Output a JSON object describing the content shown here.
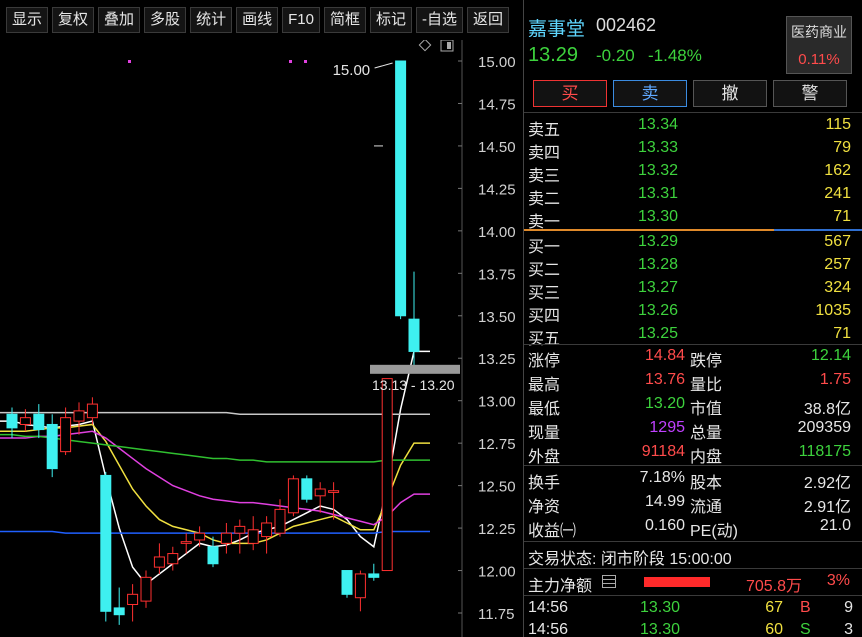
{
  "toolbar": {
    "buttons": [
      "显示",
      "复权",
      "叠加",
      "多股",
      "统计",
      "画线",
      "F10",
      "简框",
      "标记",
      "-自选",
      "返回"
    ]
  },
  "chart": {
    "price_axis": [
      "15.00",
      "14.75",
      "14.50",
      "14.25",
      "14.00",
      "13.75",
      "13.50",
      "13.25",
      "13.00",
      "12.75",
      "12.50",
      "12.25",
      "12.00",
      "11.75"
    ],
    "high_marker": "15.00",
    "range_label": "13.13 - 13.20",
    "colors": {
      "up": "#ff3030",
      "down": "#3ef0f0",
      "ma5": "#ffffff",
      "ma10": "#f0e040",
      "ma20": "#e040e0",
      "ma60": "#30c030",
      "ma120": "#2060ff",
      "ma250": "#c8c8c8"
    }
  },
  "chart_data": {
    "type": "candlestick",
    "ylim": [
      11.65,
      15.12
    ],
    "candles": [
      {
        "o": 12.92,
        "h": 12.96,
        "c": 12.84,
        "l": 12.78
      },
      {
        "o": 12.86,
        "h": 12.95,
        "c": 12.9,
        "l": 12.82
      },
      {
        "o": 12.92,
        "h": 12.98,
        "c": 12.83,
        "l": 12.78
      },
      {
        "o": 12.86,
        "h": 12.92,
        "c": 12.6,
        "l": 12.55
      },
      {
        "o": 12.7,
        "h": 12.96,
        "c": 12.9,
        "l": 12.68
      },
      {
        "o": 12.88,
        "h": 12.99,
        "c": 12.94,
        "l": 12.8
      },
      {
        "o": 12.9,
        "h": 13.02,
        "c": 12.98,
        "l": 12.86
      },
      {
        "o": 12.56,
        "h": 12.58,
        "c": 11.76,
        "l": 11.7
      },
      {
        "o": 11.78,
        "h": 11.9,
        "c": 11.74,
        "l": 11.68
      },
      {
        "o": 11.8,
        "h": 11.92,
        "c": 11.86,
        "l": 11.7
      },
      {
        "o": 11.82,
        "h": 12.0,
        "c": 11.96,
        "l": 11.78
      },
      {
        "o": 12.02,
        "h": 12.16,
        "c": 12.08,
        "l": 11.98
      },
      {
        "o": 12.04,
        "h": 12.14,
        "c": 12.1,
        "l": 12.0
      },
      {
        "o": 12.16,
        "h": 12.22,
        "c": 12.17,
        "l": 12.1
      },
      {
        "o": 12.18,
        "h": 12.26,
        "c": 12.22,
        "l": 12.14
      },
      {
        "o": 12.14,
        "h": 12.2,
        "c": 12.04,
        "l": 12.02
      },
      {
        "o": 12.16,
        "h": 12.28,
        "c": 12.22,
        "l": 12.1
      },
      {
        "o": 12.22,
        "h": 12.3,
        "c": 12.26,
        "l": 12.1
      },
      {
        "o": 12.16,
        "h": 12.32,
        "c": 12.24,
        "l": 12.12
      },
      {
        "o": 12.2,
        "h": 12.32,
        "c": 12.28,
        "l": 12.1
      },
      {
        "o": 12.22,
        "h": 12.42,
        "c": 12.36,
        "l": 12.2
      },
      {
        "o": 12.34,
        "h": 12.56,
        "c": 12.54,
        "l": 12.32
      },
      {
        "o": 12.54,
        "h": 12.56,
        "c": 12.42,
        "l": 12.4
      },
      {
        "o": 12.44,
        "h": 12.52,
        "c": 12.48,
        "l": 12.34
      },
      {
        "o": 12.46,
        "h": 12.52,
        "c": 12.47,
        "l": 12.3
      },
      {
        "o": 12.0,
        "h": 12.0,
        "c": 11.86,
        "l": 11.84
      },
      {
        "o": 11.84,
        "h": 12.0,
        "c": 11.98,
        "l": 11.76
      },
      {
        "o": 11.98,
        "h": 12.04,
        "c": 11.96,
        "l": 11.94
      },
      {
        "o": 12.0,
        "h": 13.13,
        "c": 13.13,
        "l": 12.0
      },
      {
        "o": 15.0,
        "h": 15.0,
        "c": 13.5,
        "l": 13.48
      },
      {
        "o": 13.48,
        "h": 13.76,
        "c": 13.29,
        "l": 13.2
      }
    ],
    "ma_lines": [
      {
        "name": "MA5",
        "values": [
          12.88,
          12.86,
          12.85,
          12.84,
          12.85,
          12.86,
          12.88,
          12.55,
          12.25,
          12.02,
          11.92,
          11.98,
          12.04,
          12.1,
          12.16,
          12.14,
          12.15,
          12.18,
          12.22,
          12.24,
          12.26,
          12.3,
          12.34,
          12.38,
          12.36,
          12.3,
          12.2,
          12.14,
          12.5,
          12.95,
          13.29
        ]
      },
      {
        "name": "MA10",
        "values": [
          12.82,
          12.82,
          12.83,
          12.84,
          12.84,
          12.85,
          12.86,
          12.76,
          12.62,
          12.48,
          12.38,
          12.3,
          12.26,
          12.24,
          12.22,
          12.18,
          12.16,
          12.16,
          12.16,
          12.18,
          12.22,
          12.26,
          12.28,
          12.3,
          12.32,
          12.28,
          12.24,
          12.24,
          12.42,
          12.62,
          12.75
        ]
      },
      {
        "name": "MA20",
        "values": [
          12.78,
          12.78,
          12.79,
          12.79,
          12.8,
          12.81,
          12.82,
          12.78,
          12.72,
          12.66,
          12.6,
          12.55,
          12.5,
          12.47,
          12.44,
          12.42,
          12.41,
          12.4,
          12.4,
          12.39,
          12.38,
          12.37,
          12.36,
          12.35,
          12.33,
          12.31,
          12.29,
          12.27,
          12.32,
          12.4,
          12.45
        ]
      },
      {
        "name": "MA60",
        "values": [
          12.8,
          12.79,
          12.79,
          12.78,
          12.77,
          12.76,
          12.75,
          12.74,
          12.73,
          12.72,
          12.71,
          12.7,
          12.69,
          12.68,
          12.67,
          12.66,
          12.66,
          12.65,
          12.65,
          12.64,
          12.64,
          12.64,
          12.64,
          12.64,
          12.64,
          12.64,
          12.64,
          12.64,
          12.65,
          12.65,
          12.65
        ]
      },
      {
        "name": "MA120",
        "values": [
          12.23,
          12.23,
          12.23,
          12.23,
          12.22,
          12.22,
          12.22,
          12.22,
          12.22,
          12.22,
          12.22,
          12.22,
          12.22,
          12.22,
          12.22,
          12.22,
          12.22,
          12.22,
          12.22,
          12.22,
          12.22,
          12.22,
          12.22,
          12.22,
          12.22,
          12.22,
          12.22,
          12.22,
          12.23,
          12.23,
          12.23
        ]
      },
      {
        "name": "MA250",
        "values": [
          12.93,
          12.93,
          12.93,
          12.93,
          12.93,
          12.93,
          12.93,
          12.93,
          12.93,
          12.93,
          12.93,
          12.93,
          12.93,
          12.93,
          12.93,
          12.93,
          12.93,
          12.92,
          12.92,
          12.92,
          12.92,
          12.92,
          12.92,
          12.92,
          12.92,
          12.92,
          12.92,
          12.92,
          12.92,
          12.92,
          12.92
        ]
      }
    ]
  },
  "quote": {
    "name": "嘉事堂",
    "code": "002462",
    "price": "13.29",
    "change": "-0.20",
    "change_pct": "-1.48%",
    "sector_name": "医药商业",
    "sector_pct": "0.11%"
  },
  "actions": {
    "buy": "买",
    "sell": "卖",
    "cancel": "撤",
    "alert": "警"
  },
  "orderbook": {
    "asks": [
      {
        "label": "卖五",
        "price": "13.34",
        "vol": "115"
      },
      {
        "label": "卖四",
        "price": "13.33",
        "vol": "79"
      },
      {
        "label": "卖三",
        "price": "13.32",
        "vol": "162"
      },
      {
        "label": "卖二",
        "price": "13.31",
        "vol": "241"
      },
      {
        "label": "卖一",
        "price": "13.30",
        "vol": "71"
      }
    ],
    "bids": [
      {
        "label": "买一",
        "price": "13.29",
        "vol": "567"
      },
      {
        "label": "买二",
        "price": "13.28",
        "vol": "257"
      },
      {
        "label": "买三",
        "price": "13.27",
        "vol": "324"
      },
      {
        "label": "买四",
        "price": "13.26",
        "vol": "1035"
      },
      {
        "label": "买五",
        "price": "13.25",
        "vol": "71"
      }
    ]
  },
  "stats": [
    {
      "l": "涨停",
      "lv": "14.84",
      "lc": "red",
      "r": "跌停",
      "rv": "12.14",
      "rc": "green"
    },
    {
      "l": "最高",
      "lv": "13.76",
      "lc": "red",
      "r": "量比",
      "rv": "1.75",
      "rc": "red"
    },
    {
      "l": "最低",
      "lv": "13.20",
      "lc": "green",
      "r": "市值",
      "rv": "38.8亿",
      "rc": "white"
    },
    {
      "l": "现量",
      "lv": "1295",
      "lc": "purple",
      "r": "总量",
      "rv": "209359",
      "rc": "white"
    },
    {
      "l": "外盘",
      "lv": "91184",
      "lc": "red",
      "r": "内盘",
      "rv": "118175",
      "rc": "green"
    },
    {
      "l": "换手",
      "lv": "7.18%",
      "lc": "white",
      "r": "股本",
      "rv": "2.92亿",
      "rc": "white"
    },
    {
      "l": "净资",
      "lv": "14.99",
      "lc": "white",
      "r": "流通",
      "rv": "2.91亿",
      "rc": "white"
    },
    {
      "l": "收益㈠",
      "lv": "0.160",
      "lc": "white",
      "r": "PE(动)",
      "rv": "21.0",
      "rc": "white"
    }
  ],
  "status": {
    "trade_state": "交易状态: 闭市阶段 15:00:00",
    "main_flow_label": "主力净额",
    "main_flow_value": "705.8万",
    "main_flow_pct": "3%"
  },
  "ticks": [
    {
      "time": "14:56",
      "price": "13.30",
      "vol": "67",
      "side": "B",
      "side_color": "red",
      "count": "9"
    },
    {
      "time": "14:56",
      "price": "13.30",
      "vol": "60",
      "side": "S",
      "side_color": "green",
      "count": "3"
    }
  ]
}
